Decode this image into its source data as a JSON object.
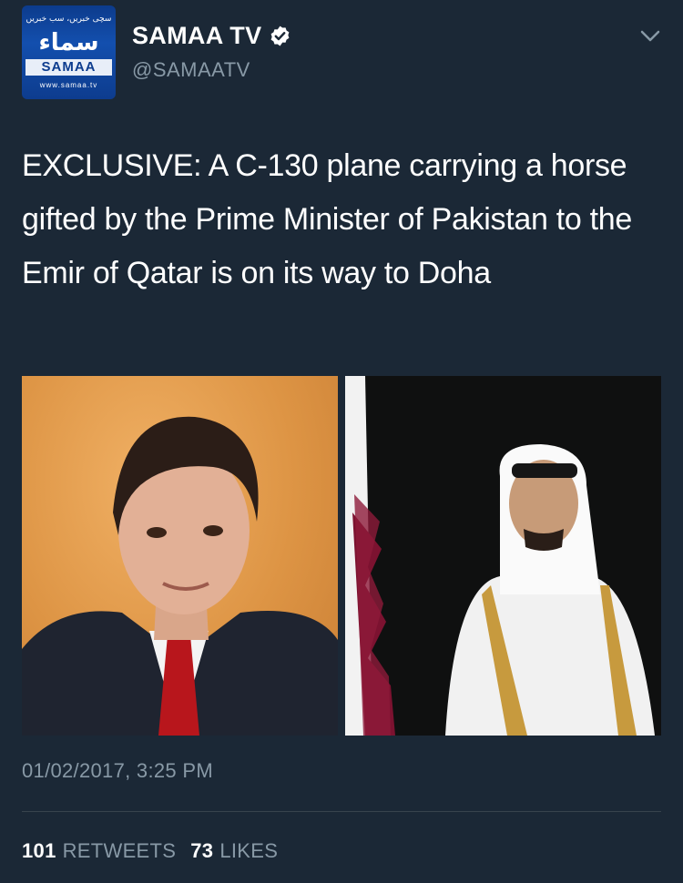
{
  "account": {
    "display_name": "SAMAA TV",
    "handle": "@SAMAATV",
    "verified": true,
    "avatar": {
      "urdu_tagline": "سچی خبریں، سب خبریں",
      "urdu_logo": "سماء",
      "brand": "SAMAA",
      "url": "www.samaa.tv"
    }
  },
  "tweet": {
    "text": "EXCLUSIVE: A C-130 plane carrying a horse gifted by the Prime Minister of Pakistan to the Emir of Qatar is on its way to Doha",
    "timestamp": "01/02/2017, 3:25 PM"
  },
  "stats": {
    "retweets_count": "101",
    "retweets_label": "RETWEETS",
    "likes_count": "73",
    "likes_label": "LIKES"
  },
  "colors": {
    "background": "#1b2836",
    "secondary_text": "#8899a6",
    "divider": "#38444d",
    "verified_badge": "#ffffff"
  },
  "icons": {
    "verified": "verified-badge-icon",
    "menu": "chevron-down-icon"
  }
}
